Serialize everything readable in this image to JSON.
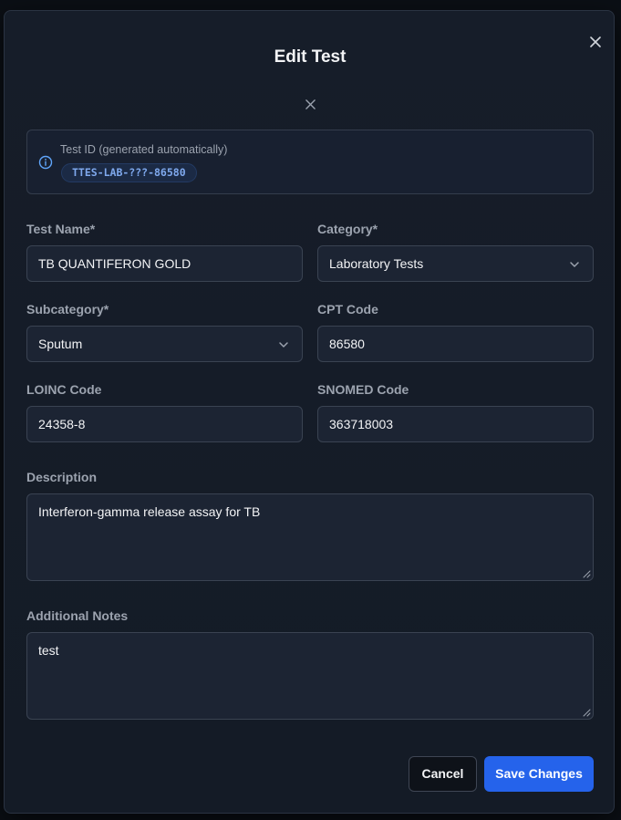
{
  "modal": {
    "title": "Edit Test"
  },
  "test_id": {
    "label": "Test ID (generated automatically)",
    "value": "TTES-LAB-???-86580"
  },
  "fields": {
    "test_name": {
      "label": "Test Name*",
      "value": "TB QUANTIFERON GOLD"
    },
    "category": {
      "label": "Category*",
      "value": "Laboratory Tests"
    },
    "subcategory": {
      "label": "Subcategory*",
      "value": "Sputum"
    },
    "cpt_code": {
      "label": "CPT Code",
      "value": "86580"
    },
    "loinc_code": {
      "label": "LOINC Code",
      "value": "24358-8"
    },
    "snomed_code": {
      "label": "SNOMED Code",
      "value": "363718003"
    },
    "description": {
      "label": "Description",
      "value": "Interferon-gamma release assay for TB"
    },
    "notes": {
      "label": "Additional Notes",
      "value": "test"
    }
  },
  "buttons": {
    "cancel": "Cancel",
    "save": "Save Changes"
  },
  "icons": {
    "close": "close-icon",
    "info": "info-icon",
    "chevron": "chevron-down-icon"
  },
  "colors": {
    "background": "#141b26",
    "accent": "#2563eb",
    "id_text": "#7fa9ee"
  }
}
